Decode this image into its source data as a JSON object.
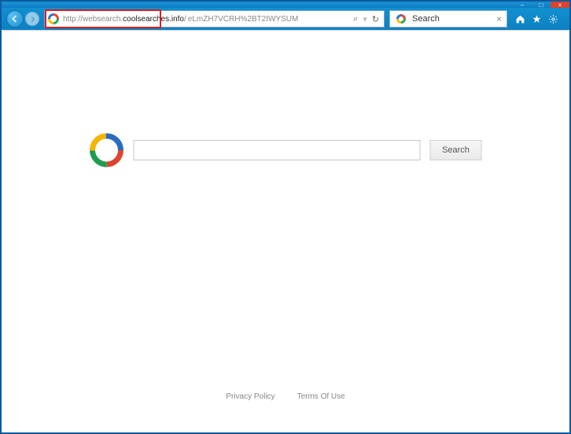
{
  "window": {
    "controls": {
      "minimize": "–",
      "maximize": "□",
      "close": "×"
    }
  },
  "nav": {
    "url_prefix": "http://websearch.",
    "url_domain": "coolsearches.info",
    "url_suffix": "/",
    "url_trailing": "eLmZH7VCRH%2BT2IWYSUM",
    "search_glyph": "⌕",
    "refresh_glyph": "↻"
  },
  "tab": {
    "title": "Search",
    "close": "×"
  },
  "page": {
    "search_button": "Search",
    "search_value": ""
  },
  "footer": {
    "privacy": "Privacy Policy",
    "terms": "Terms Of Use"
  }
}
